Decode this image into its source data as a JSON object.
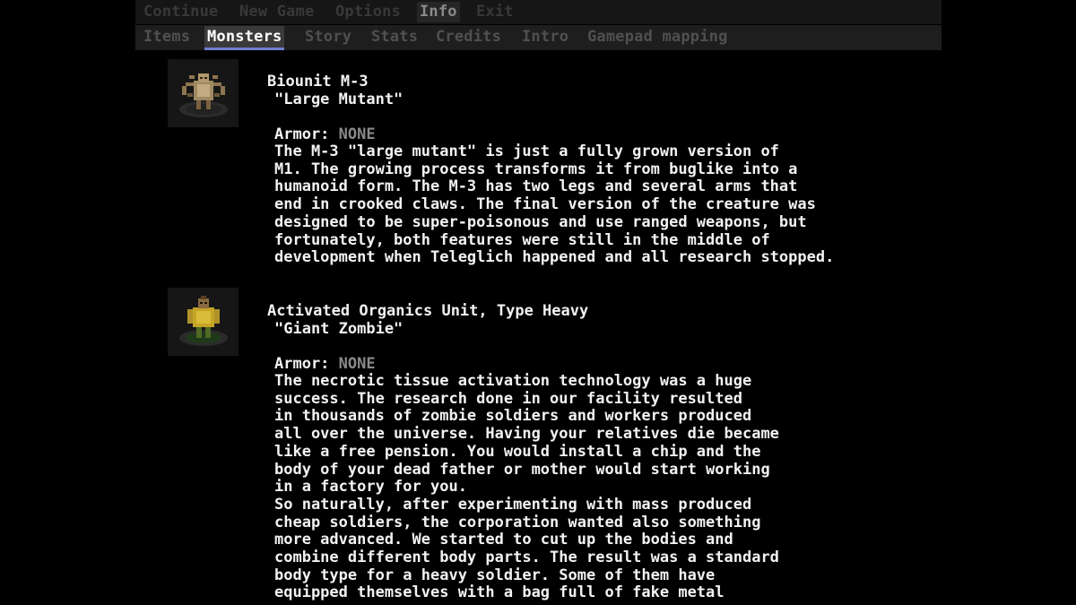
{
  "top_menu": {
    "items": [
      "Continue",
      "New Game",
      "Options",
      "Info",
      "Exit"
    ],
    "active": "Info"
  },
  "tabs": {
    "items": [
      "Items",
      "Monsters",
      "Story",
      "Stats",
      "Credits",
      "Intro",
      "Gamepad mapping"
    ],
    "active": "Monsters"
  },
  "monsters": [
    {
      "name": "Biounit M-3",
      "nickname": "\"Large Mutant\"",
      "armor_label": "Armor: ",
      "armor_value": "NONE",
      "description": "The M-3 \"large mutant\" is just a fully grown version of\nM1. The growing process transforms it from buglike into a\nhumanoid form. The M-3 has two legs and several arms that\nend in crooked claws. The final version of the creature was\ndesigned to be super-poisonous and use ranged weapons, but\nfortunately, both features were still in the middle of\ndevelopment when Teleglich happened and all research stopped.",
      "icon": "mutant-sprite-icon"
    },
    {
      "name": "Activated Organics Unit, Type Heavy",
      "nickname": "\"Giant Zombie\"",
      "armor_label": "Armor: ",
      "armor_value": "NONE",
      "description": "The necrotic tissue activation technology was a huge\nsuccess. The research done in our facility resulted\nin thousands of zombie soldiers and workers produced\nall over the universe. Having your relatives die became\nlike a free pension. You would install a chip and the\nbody of your dead father or mother would start working\nin a factory for you.\nSo naturally, after experimenting with mass produced\ncheap soldiers, the corporation wanted also something\nmore advanced. We started to cut up the bodies and\ncombine different body parts. The result was a standard\nbody type for a heavy soldier. Some of them have\nequipped themselves with a bag full of fake metal",
      "icon": "zombie-sprite-icon"
    }
  ]
}
